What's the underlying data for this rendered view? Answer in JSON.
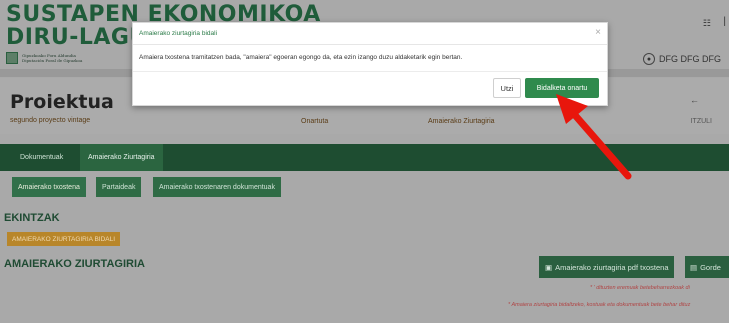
{
  "header": {
    "title_line1": "SUSTAPEN EKONOMIKOA",
    "title_line2": "DIRU-LAGUNTZAK",
    "logo_text_1": "Gipuzkoako Foru Aldundia",
    "logo_text_2": "Diputación Foral de Gipuzkoa",
    "top_icon": "☷",
    "user_name": "DFG DFG DFG"
  },
  "project": {
    "heading": "Proiektua",
    "name": "segundo proyecto vintage",
    "status": "Onartuta",
    "phase": "Amaierako Ziurtagiria",
    "back_label": "ITZULI"
  },
  "tabs": [
    {
      "label": "Dokumentuak"
    },
    {
      "label": "Amaierako Ziurtagiria"
    }
  ],
  "subtabs": [
    {
      "label": "Amaierako txostena"
    },
    {
      "label": "Partaideak"
    },
    {
      "label": "Amaierako txostenaren dokumentuak"
    }
  ],
  "section_actions": {
    "title": "EKINTZAK",
    "send_button": "AMAIERAKO ZIURTAGIRIA BIDALI"
  },
  "section_certificate": {
    "title": "AMAIERAKO ZIURTAGIRIA",
    "pdf_button": "Amaierako ziurtagiria pdf txostena",
    "save_button": "Gorde",
    "note1": "* ' dituzten eremuak betebeharrezkoak di",
    "note2": "* Amaiera ziurtagiria bidaltzeko, kostuak eta dokumentuak bete behar dituz"
  },
  "modal": {
    "title": "Amaierako ziurtagiria bidali",
    "message": "Amaiera txostena tramitatzen bada, \"amaiera\" egoeran egongo da, eta ezin izango duzu aldaketarik egin bertan.",
    "cancel_label": "Utzi",
    "confirm_label": "Bidalketa onartu",
    "close_icon": "×"
  },
  "colors": {
    "accent_green": "#2f8a4d",
    "dark_green": "#1e4d31",
    "orange": "#b8862a",
    "annotation_red": "#e8160c"
  }
}
